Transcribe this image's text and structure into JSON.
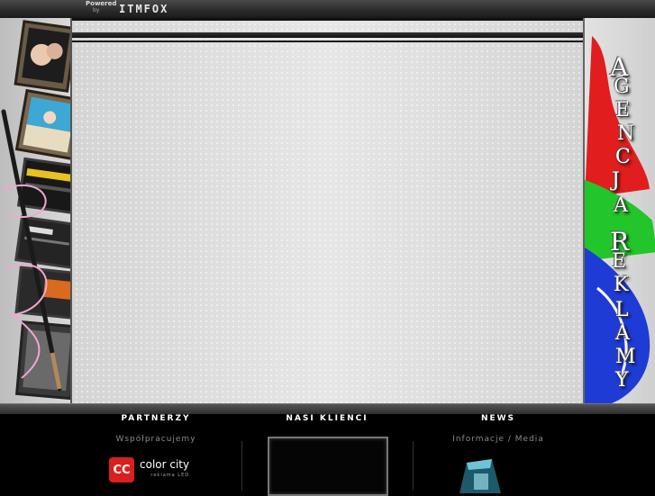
{
  "top_bar": {
    "powered_label": "Powered",
    "by_label": "by",
    "brand": "ITMFOX"
  },
  "side_title_letters": [
    {
      "char": "A"
    },
    {
      "char": "G"
    },
    {
      "char": "E"
    },
    {
      "char": "N"
    },
    {
      "char": "C"
    },
    {
      "char": "J"
    },
    {
      "char": "A"
    },
    {
      "char": "R"
    },
    {
      "char": "E"
    },
    {
      "char": "K"
    },
    {
      "char": "L"
    },
    {
      "char": "A"
    },
    {
      "char": "M"
    },
    {
      "char": "Y"
    }
  ],
  "footer": {
    "partners": {
      "title": "PARTNERZY",
      "subtitle": "Współpracujemy"
    },
    "clients": {
      "title": "NASI KLIENCI"
    },
    "news": {
      "title": "NEWS",
      "subtitle": "Informacje / Media"
    }
  },
  "partner_logo": {
    "mark": "CC",
    "name": "color city",
    "tagline": "reklama LED",
    "color": "#d9201f"
  },
  "colors": {
    "accent_red": "#d9201f",
    "stripe_dark": "#111111",
    "footer_bg": "#000000"
  }
}
